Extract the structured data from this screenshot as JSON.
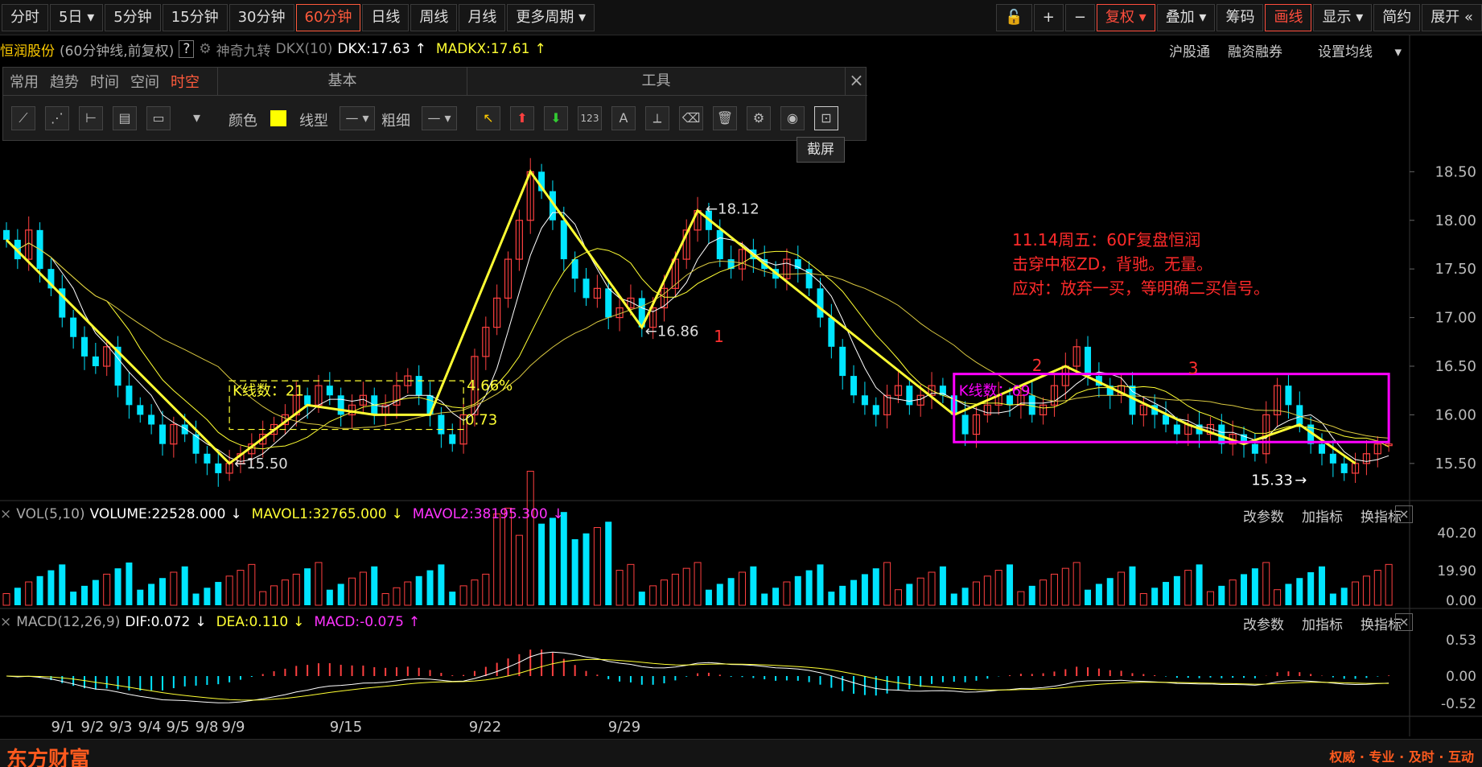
{
  "periods": [
    "分时",
    "5日",
    "5分钟",
    "15分钟",
    "30分钟",
    "60分钟",
    "日线",
    "周线",
    "月线",
    "更多周期"
  ],
  "active_period": "60分钟",
  "right_tools": {
    "zoom_in": "+",
    "zoom_out": "−",
    "fuquan": "复权",
    "diejia": "叠加",
    "chouma": "筹码",
    "huaxian": "画线",
    "xianshi": "显示",
    "jianyue": "简约",
    "zhankai": "展开"
  },
  "info": {
    "stock": "恒润股份",
    "mode": "(60分钟线,前复权)",
    "help": "?",
    "indicator": "神奇九转",
    "dkx_name": "DKX(10)",
    "dkx": "DKX:17.63",
    "dkx_arrow": "↑",
    "madkx": "MADKX:17.61",
    "madkx_arrow": "↑"
  },
  "info_right": [
    "沪股通",
    "融资融券",
    "设置均线"
  ],
  "draw_panel": {
    "tabs": [
      "常用",
      "趋势",
      "时间",
      "空间",
      "时空"
    ],
    "active_tab": "时空",
    "basic_title": "基本",
    "tool_title": "工具",
    "color_label": "颜色",
    "line_type_label": "线型",
    "thickness_label": "粗细",
    "tool_text": "123",
    "tool_a": "A",
    "close": "×"
  },
  "tooltip": "截屏",
  "colors": {
    "up": "#ff4040",
    "down": "#00e5ff",
    "yellow": "#ffff33",
    "magenta": "#ff00ff",
    "orange": "#ff9900",
    "white": "#ffffff",
    "background": "#000000"
  },
  "chart_data": {
    "type": "candlestick",
    "title": "恒润股份 (60分钟线,前复权)",
    "y_ticks": [
      18.5,
      18.0,
      17.5,
      17.0,
      16.5,
      16.0,
      15.5
    ],
    "ylim": [
      15.3,
      18.9
    ],
    "x_ticks": [
      "9/1",
      "9/2",
      "9/3",
      "9/4",
      "9/5",
      "9/8",
      "9/9",
      "9/15",
      "9/22",
      "9/29"
    ],
    "closes": [
      17.8,
      17.6,
      17.9,
      17.5,
      17.3,
      17.0,
      16.8,
      16.6,
      16.5,
      16.7,
      16.3,
      16.1,
      16.0,
      15.9,
      15.7,
      15.9,
      15.8,
      15.6,
      15.5,
      15.4,
      15.5,
      15.6,
      15.7,
      15.8,
      15.9,
      16.0,
      16.2,
      16.1,
      16.3,
      16.2,
      16.0,
      16.1,
      16.2,
      16.0,
      16.1,
      16.3,
      16.4,
      16.2,
      16.0,
      15.8,
      15.7,
      16.0,
      16.6,
      16.9,
      17.2,
      17.6,
      18.0,
      18.5,
      18.3,
      18.0,
      17.6,
      17.4,
      17.2,
      17.3,
      17.0,
      17.1,
      17.2,
      16.9,
      17.1,
      17.3,
      17.6,
      17.9,
      18.1,
      17.9,
      17.6,
      17.5,
      17.7,
      17.6,
      17.5,
      17.4,
      17.6,
      17.5,
      17.3,
      17.0,
      16.7,
      16.4,
      16.2,
      16.1,
      16.0,
      16.2,
      16.3,
      16.1,
      16.2,
      16.3,
      16.2,
      16.0,
      15.8,
      16.0,
      16.1,
      16.2,
      16.1,
      16.2,
      16.0,
      16.1,
      16.3,
      16.5,
      16.7,
      16.4,
      16.3,
      16.2,
      16.3,
      16.0,
      16.1,
      16.0,
      15.9,
      15.8,
      15.9,
      15.8,
      15.9,
      15.7,
      15.8,
      15.7,
      15.6,
      16.0,
      16.3,
      16.1,
      15.9,
      15.7,
      15.6,
      15.5,
      15.4,
      15.5,
      15.6,
      15.7,
      15.7
    ],
    "annotations": [
      {
        "text": "11.14周五：60F复盘恒润"
      },
      {
        "text": "击穿中枢ZD，背驰。无量。"
      },
      {
        "text": "应对：放弃一买，等明确二买信号。"
      }
    ],
    "price_labels": {
      "p1": "←18.12",
      "p2": "←16.86",
      "p3": "←15.50",
      "p4": "15.33",
      "p4_arrow": "→"
    },
    "box_label_1": "K线数：21",
    "box_pct": "4.66%",
    "box_ratio": "0.73",
    "box_label_2": "K线数：69",
    "seg_labels": [
      "1",
      "2",
      "3"
    ]
  },
  "volume": {
    "header": "VOL(5,10)",
    "volume": "VOLUME:22528.000",
    "volume_arrow": "↓",
    "mavol1": "MAVOL1:32765.000",
    "mavol1_arrow": "↓",
    "mavol2": "MAVOL2:38195.300",
    "mavol2_arrow": "↓",
    "y_ticks": [
      "40.20",
      "19.90",
      "0.00"
    ]
  },
  "macd": {
    "header": "MACD(12,26,9)",
    "dif": "DIF:0.072",
    "dif_arrow": "↓",
    "dea": "DEA:0.110",
    "dea_arrow": "↓",
    "macd": "MACD:-0.075",
    "macd_arrow": "↑",
    "y_ticks": [
      "0.53",
      "0.00",
      "-0.52"
    ]
  },
  "sub_tools": [
    "改参数",
    "加指标",
    "换指标"
  ],
  "sub_close": "×",
  "bottom": {
    "logo": "东方财富",
    "slogan": "权威 · 专业 · 及时 · 互动"
  }
}
